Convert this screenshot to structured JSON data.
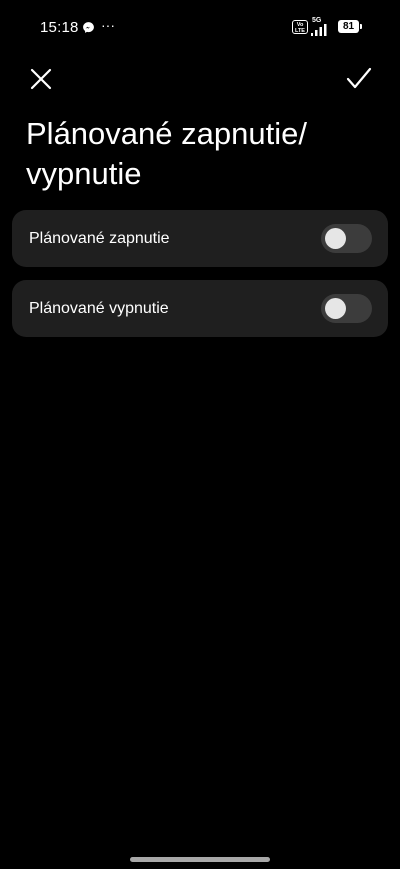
{
  "status_bar": {
    "time": "15:18",
    "more": "···",
    "volte": "Vo LTE",
    "network": "5G",
    "battery": "81",
    "icons": [
      "messenger-icon",
      "volte-icon",
      "signal-icon",
      "battery-icon"
    ]
  },
  "header": {
    "close_icon": "close-icon",
    "confirm_icon": "check-icon",
    "title": "Plánované zapnutie/ vypnutie"
  },
  "settings": {
    "items": [
      {
        "label": "Plánované zapnutie",
        "enabled": false
      },
      {
        "label": "Plánované vypnutie",
        "enabled": false
      }
    ]
  },
  "colors": {
    "background": "#000000",
    "card": "#1f1f1f",
    "toggle_track_off": "#3c3c3c",
    "toggle_knob": "#e6e6e6",
    "text": "#ffffff"
  }
}
